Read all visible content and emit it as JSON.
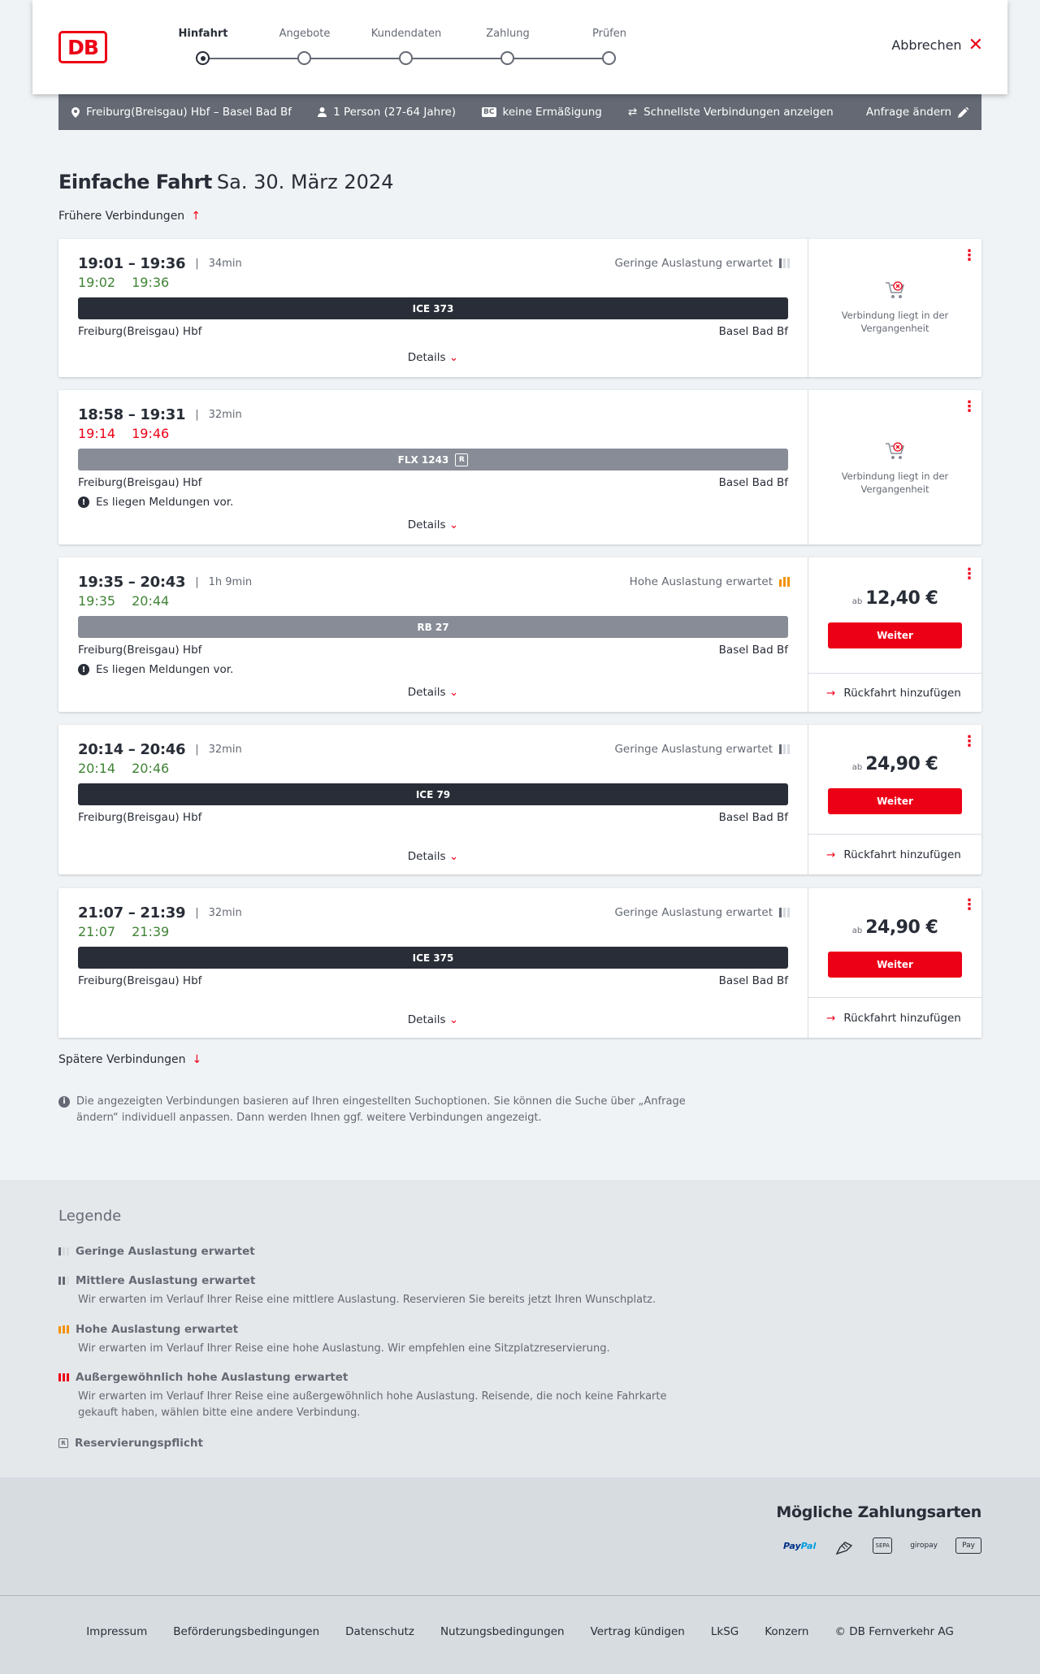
{
  "header": {
    "logo_text": "DB",
    "steps": [
      "Hinfahrt",
      "Angebote",
      "Kundendaten",
      "Zahlung",
      "Prüfen"
    ],
    "active_step": 0,
    "cancel_label": "Abbrechen"
  },
  "request": {
    "route": "Freiburg(Breisgau) Hbf – Basel Bad Bf",
    "travellers": "1 Person (27-64 Jahre)",
    "bc_badge": "BC",
    "discount": "keine Ermäßigung",
    "fastest": "Schnellste Verbindungen anzeigen",
    "edit": "Anfrage ändern"
  },
  "page": {
    "title": "Einfache Fahrt",
    "date": "Sa. 30. März 2024",
    "earlier": "Frühere Verbindungen",
    "later": "Spätere Verbindungen",
    "details_label": "Details",
    "info": "Die angezeigten Verbindungen basieren auf Ihren eingestellten Suchoptionen. Sie können die Suche über „Anfrage ändern“ individuell anpassen. Dann werden Ihnen ggf. weitere Verbindungen angezeigt.",
    "past_text": "Verbindung liegt in der Vergangenheit",
    "ab": "ab",
    "weiter": "Weiter",
    "return_label": "Rückfahrt hinzufügen"
  },
  "connections": [
    {
      "times": "19:01 – 19:36",
      "duration": "34min",
      "rt_dep": "19:02",
      "rt_arr": "19:36",
      "rt_status": "ontime",
      "load": "Geringe Auslastung erwartet",
      "load_level": "low",
      "train": "ICE 373",
      "train_style": "dark",
      "reservation": "",
      "from": "Freiburg(Breisgau) Hbf",
      "to": "Basel Bad Bf",
      "message": "",
      "price": "",
      "past": true
    },
    {
      "times": "18:58 – 19:31",
      "duration": "32min",
      "rt_dep": "19:14",
      "rt_arr": "19:46",
      "rt_status": "delayed",
      "load": "",
      "load_level": "",
      "train": "FLX 1243",
      "train_style": "grey",
      "reservation": "R",
      "from": "Freiburg(Breisgau) Hbf",
      "to": "Basel Bad Bf",
      "message": "Es liegen Meldungen vor.",
      "price": "",
      "past": true
    },
    {
      "times": "19:35 – 20:43",
      "duration": "1h 9min",
      "rt_dep": "19:35",
      "rt_arr": "20:44",
      "rt_status": "ontime",
      "load": "Hohe Auslastung erwartet",
      "load_level": "high",
      "train": "RB 27",
      "train_style": "grey",
      "reservation": "",
      "from": "Freiburg(Breisgau) Hbf",
      "to": "Basel Bad Bf",
      "message": "Es liegen Meldungen vor.",
      "price": "12,40 €",
      "past": false
    },
    {
      "times": "20:14 – 20:46",
      "duration": "32min",
      "rt_dep": "20:14",
      "rt_arr": "20:46",
      "rt_status": "ontime",
      "load": "Geringe Auslastung erwartet",
      "load_level": "low",
      "train": "ICE 79",
      "train_style": "dark",
      "reservation": "",
      "from": "Freiburg(Breisgau) Hbf",
      "to": "Basel Bad Bf",
      "message": "",
      "price": "24,90 €",
      "past": false
    },
    {
      "times": "21:07 – 21:39",
      "duration": "32min",
      "rt_dep": "21:07",
      "rt_arr": "21:39",
      "rt_status": "ontime",
      "load": "Geringe Auslastung erwartet",
      "load_level": "low",
      "train": "ICE 375",
      "train_style": "dark",
      "reservation": "",
      "from": "Freiburg(Breisgau) Hbf",
      "to": "Basel Bad Bf",
      "message": "",
      "price": "24,90 €",
      "past": false
    }
  ],
  "legend": {
    "title": "Legende",
    "items": [
      {
        "title": "Geringe Auslastung erwartet",
        "desc": ""
      },
      {
        "title": "Mittlere Auslastung erwartet",
        "desc": "Wir erwarten im Verlauf Ihrer Reise eine mittlere Auslastung. Reservieren Sie bereits jetzt Ihren Wunschplatz."
      },
      {
        "title": "Hohe Auslastung erwartet",
        "desc": "Wir erwarten im Verlauf Ihrer Reise eine hohe Auslastung. Wir empfehlen eine Sitzplatzreservierung."
      },
      {
        "title": "Außergewöhnlich hohe Auslastung erwartet",
        "desc": "Wir erwarten im Verlauf Ihrer Reise eine außergewöhnlich hohe Auslastung. Reisende, die noch keine Fahrkarte gekauft haben, wählen bitte eine andere Verbindung."
      },
      {
        "title": "Reservierungspflicht",
        "desc": ""
      }
    ]
  },
  "payment": {
    "title": "Mögliche Zahlungsarten",
    "methods": [
      "PayPal",
      "giropay",
      "Apple Pay"
    ],
    "sepa": "SEPA",
    "applepay": "Pay"
  },
  "footer": {
    "links": [
      "Impressum",
      "Beförderungsbedingungen",
      "Datenschutz",
      "Nutzungsbedingungen",
      "Vertrag kündigen",
      "LkSG",
      "Konzern",
      "© DB Fernverkehr AG"
    ]
  },
  "colors": {
    "brand": "#ec0016",
    "ontime": "#408335",
    "high_load": "#f39200",
    "train_dark": "#282d37",
    "train_grey": "#878c96"
  }
}
